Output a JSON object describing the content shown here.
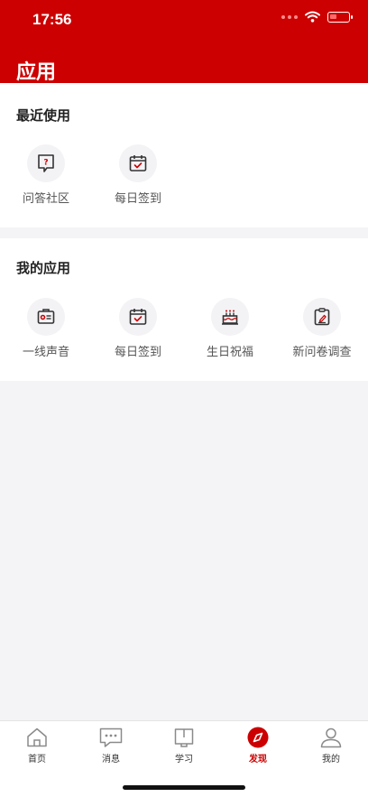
{
  "status_bar": {
    "time": "17:56"
  },
  "header": {
    "title": "应用"
  },
  "recent": {
    "title": "最近使用",
    "items": [
      {
        "label": "问答社区",
        "icon": "qa-community-icon"
      },
      {
        "label": "每日签到",
        "icon": "calendar-check-icon"
      }
    ]
  },
  "mine": {
    "title": "我的应用",
    "items": [
      {
        "label": "一线声音",
        "icon": "voice-card-icon"
      },
      {
        "label": "每日签到",
        "icon": "calendar-check-icon"
      },
      {
        "label": "生日祝福",
        "icon": "birthday-cake-icon"
      },
      {
        "label": "新问卷调查",
        "icon": "clipboard-edit-icon"
      }
    ]
  },
  "tabbar": {
    "active": "发现",
    "accent": "#cc0000",
    "items": [
      {
        "label": "首页",
        "icon": "home-icon"
      },
      {
        "label": "消息",
        "icon": "message-icon"
      },
      {
        "label": "学习",
        "icon": "book-icon"
      },
      {
        "label": "发现",
        "icon": "compass-icon"
      },
      {
        "label": "我的",
        "icon": "user-icon"
      }
    ]
  }
}
